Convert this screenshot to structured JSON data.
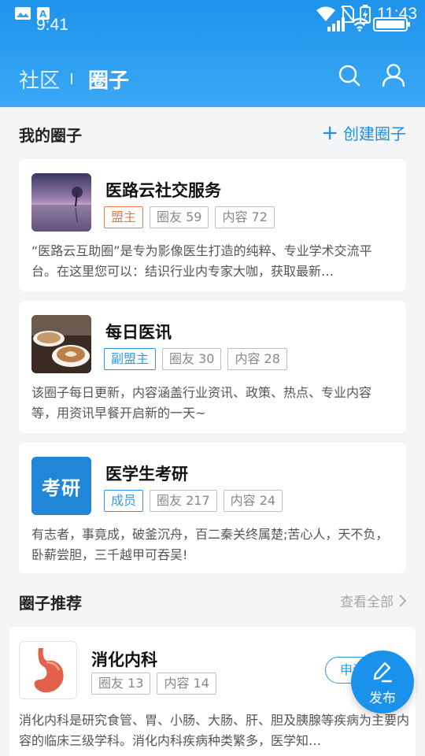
{
  "status_bar": {
    "time_left": "9:41",
    "time_right": "11:43"
  },
  "header": {
    "tab_community": "社区",
    "tab_circle": "圈子"
  },
  "my_circles": {
    "title": "我的圈子",
    "create_label": "创建圈子",
    "items": [
      {
        "name": "医路云社交服务",
        "role": "盟主",
        "members": "圈友 59",
        "content": "内容 72",
        "desc": "“医路云互助圈”是专为影像医生打造的纯粹、专业学术交流平台。在这里您可以：结识行业内专家大咖，获取最新…"
      },
      {
        "name": "每日医讯",
        "role": "副盟主",
        "members": "圈友 30",
        "content": "内容 28",
        "desc": "该圈子每日更新，内容涵盖行业资讯、政策、热点、专业内容等，用资讯早餐开启新的一天~"
      },
      {
        "name": "医学生考研",
        "role": "成员",
        "members": "圈友 217",
        "content": "内容 24",
        "desc": "有志者，事竟成，破釜沉舟，百二秦关终属楚;苦心人，天不负，卧薪尝胆，三千越甲可吞吴!",
        "thumb_text": "考研"
      }
    ]
  },
  "recommend": {
    "title": "圈子推荐",
    "see_all": "查看全部",
    "items": [
      {
        "name": "消化内科",
        "members": "圈友 13",
        "content": "内容 14",
        "apply": "申请",
        "desc": "消化内科是研究食管、胃、小肠、大肠、肝、胆及胰腺等疾病为主要内容的临床三级学科。消化内科疾病种类繁多，医学知…"
      }
    ]
  },
  "fab": {
    "label": "发布"
  },
  "colors": {
    "primary": "#1e93ec",
    "orange": "#ee7a3e"
  }
}
